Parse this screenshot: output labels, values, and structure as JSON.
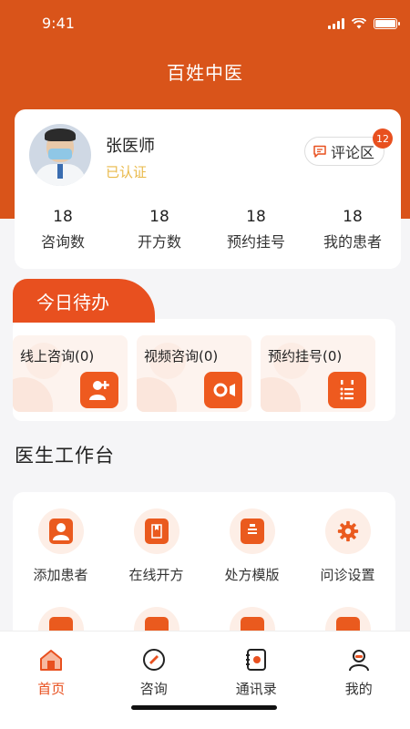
{
  "status_bar": {
    "time": "9:41"
  },
  "app_title": "百姓中医",
  "profile": {
    "name": "张医师",
    "status": "已认证",
    "comment_label": "评论区",
    "comment_badge": "12",
    "stats": [
      {
        "value": "18",
        "label": "咨询数"
      },
      {
        "value": "18",
        "label": "开方数"
      },
      {
        "value": "18",
        "label": "预约挂号"
      },
      {
        "value": "18",
        "label": "我的患者"
      }
    ]
  },
  "todo": {
    "title": "今日待办",
    "items": [
      {
        "label": "线上咨询(0)",
        "icon": "user-add-icon"
      },
      {
        "label": "视频咨询(0)",
        "icon": "video-camera-icon"
      },
      {
        "label": "预约挂号(0)",
        "icon": "calendar-list-icon"
      }
    ]
  },
  "workbench": {
    "title": "医生工作台",
    "items": [
      {
        "label": "添加患者",
        "icon": "add-patient-icon"
      },
      {
        "label": "在线开方",
        "icon": "prescription-book-icon"
      },
      {
        "label": "处方模版",
        "icon": "template-icon"
      },
      {
        "label": "问诊设置",
        "icon": "gear-icon"
      },
      {
        "label": "",
        "icon": "briefcase-icon"
      },
      {
        "label": "",
        "icon": "document-icon"
      },
      {
        "label": "",
        "icon": "clipboard-icon"
      },
      {
        "label": "",
        "icon": "bell-icon"
      }
    ]
  },
  "tabbar": {
    "tabs": [
      {
        "label": "首页",
        "icon": "home-icon",
        "active": true
      },
      {
        "label": "咨询",
        "icon": "consult-icon",
        "active": false
      },
      {
        "label": "通讯录",
        "icon": "contacts-icon",
        "active": false
      },
      {
        "label": "我的",
        "icon": "profile-icon",
        "active": false
      }
    ]
  },
  "colors": {
    "brand": "#d9541a",
    "accent": "#e8501f",
    "verified": "#e9b949"
  }
}
